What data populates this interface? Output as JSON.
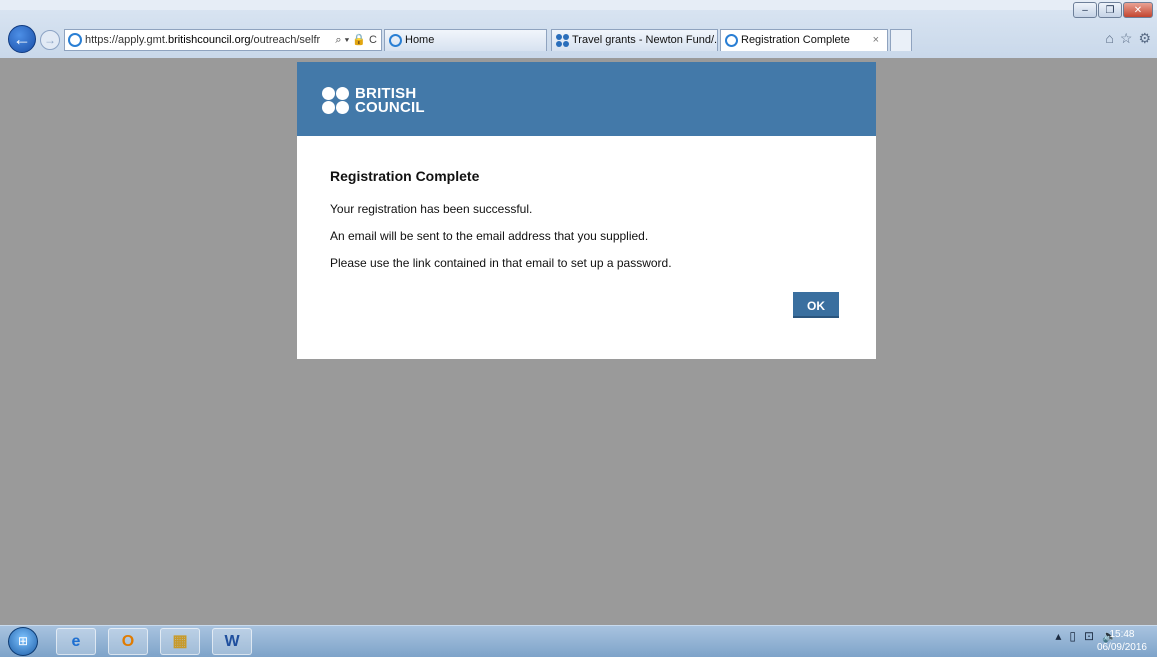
{
  "browser": {
    "url_prefix": "https://apply.gmt.",
    "url_domain": "britishcouncil.org",
    "url_path": "/outreach/selfr",
    "addr_tools": "⌕ ▾ 🔒 C",
    "tabs": [
      {
        "label": "Home"
      },
      {
        "label": "Travel grants - Newton Fund/..."
      },
      {
        "label": "Registration Complete"
      }
    ],
    "tab_close": "×",
    "right_icons": [
      "⌂",
      "☆",
      "⚙"
    ]
  },
  "window_controls": [
    "–",
    "❐",
    "✕"
  ],
  "modal": {
    "logo_line1": "BRITISH",
    "logo_line2": "COUNCIL",
    "title": "Registration Complete",
    "messages": [
      "Your registration has been successful.",
      "An email will be sent to the email address that you supplied.",
      "Please use the link contained in that email to set up a password."
    ],
    "ok_label": "OK"
  },
  "taskbar": {
    "apps": [
      "e",
      "O",
      "▦",
      "W"
    ],
    "tray": [
      "▴",
      "▯",
      "⊡",
      "🔈"
    ],
    "time": "15:48",
    "date": "06/09/2016"
  },
  "colors": {
    "header": "#4379a9",
    "ok_button": "#3a6f9f",
    "overlay": "#9a9a9a"
  }
}
